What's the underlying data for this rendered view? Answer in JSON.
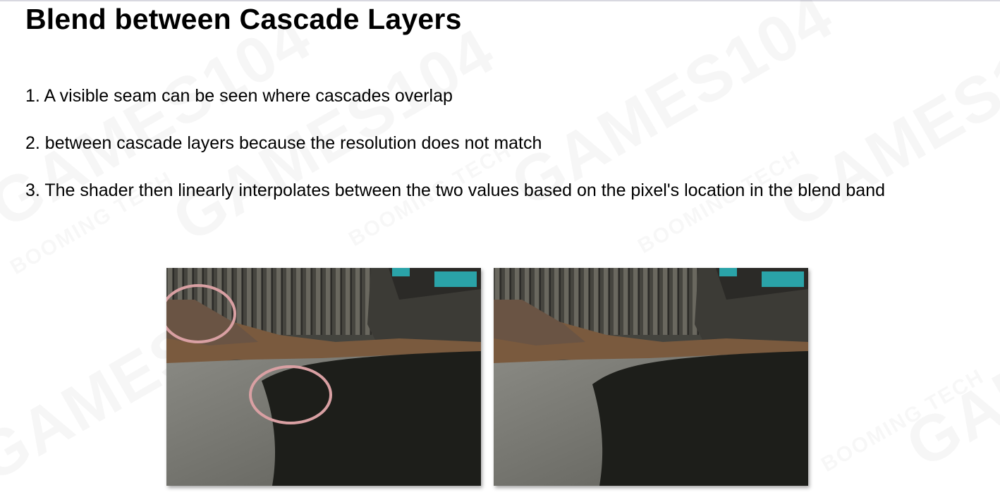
{
  "slide": {
    "title": "Blend between Cascade Layers",
    "bullets": [
      "1. A visible seam can be seen where cascades overlap",
      "2. between cascade layers because the resolution does not match",
      "3. The shader then linearly interpolates between the two values based on the pixel's location in the blend band"
    ]
  },
  "watermark": {
    "brand": "GAMES104",
    "sub": "BOOMING TECH"
  },
  "figures": {
    "left": {
      "highlight_color": "#d9a0a3"
    },
    "right": {}
  }
}
